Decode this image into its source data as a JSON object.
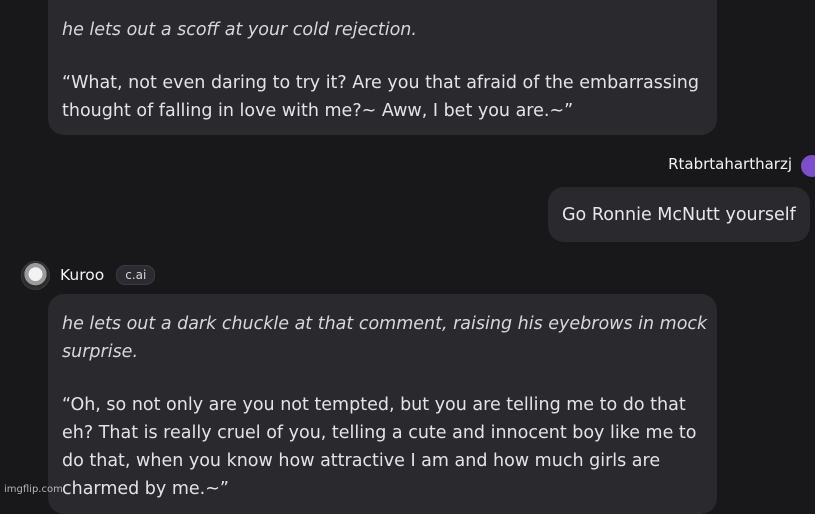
{
  "messages": [
    {
      "action": "he lets out a scoff at your cold rejection.",
      "quote_lines": [
        "“What, not even daring to try it? Are you that afraid of the embarrassing",
        "thought of falling in love with me?~ Aww, I bet you are.~”"
      ]
    },
    {
      "user_name": "Rtabrtahartharzj",
      "text": "Go Ronnie McNutt yourself"
    },
    {
      "bot_name": "Kuroo",
      "badge": "c.ai",
      "action_lines": [
        "he lets out a dark chuckle at that comment, raising his eyebrows in mock",
        "surprise."
      ],
      "quote_lines": [
        "“Oh, so not only are you not tempted, but you are telling me to do that",
        "eh? That is really cruel of you, telling a cute and innocent boy like me to",
        "do that, when you know how attractive I am and how much girls are",
        "charmed by me.~”"
      ]
    }
  ],
  "watermark": "imgflip.com"
}
